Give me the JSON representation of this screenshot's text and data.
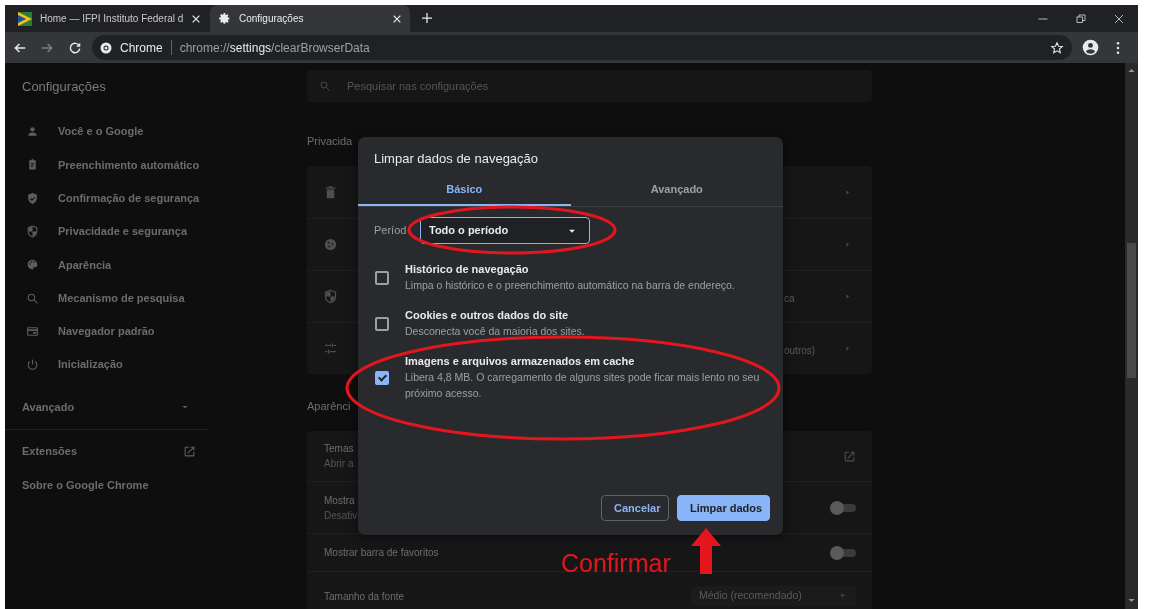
{
  "browser": {
    "tabs": [
      {
        "title": "Home — IFPI Instituto Federal d",
        "selected": false
      },
      {
        "title": "Configurações",
        "selected": true
      }
    ],
    "forward": {
      "disabled": true
    },
    "address": {
      "origin": "Chrome",
      "url": [
        {
          "text": "chrome://",
          "emphasized": false
        },
        {
          "text": "settings",
          "emphasized": true
        },
        {
          "text": "/clearBrowserData",
          "emphasized": false
        }
      ]
    }
  },
  "settings": {
    "title": "Configurações",
    "search": {
      "placeholder": "Pesquisar nas configurações"
    }
  },
  "sidebar": {
    "items": [
      {
        "label": "Você e o Google"
      },
      {
        "label": "Preenchimento automático"
      },
      {
        "label": "Confirmação de segurança"
      },
      {
        "label": "Privacidade e segurança"
      },
      {
        "label": "Aparência"
      },
      {
        "label": "Mecanismo de pesquisa"
      },
      {
        "label": "Navegador padrão"
      },
      {
        "label": "Inicialização"
      }
    ],
    "advanced": {
      "label": "Avançado",
      "expanded": false
    },
    "links": [
      {
        "label": "Extensões",
        "external": true
      },
      {
        "label": "Sobre o Google Chrome",
        "external": false
      }
    ]
  },
  "sections": [
    {
      "heading": "Privacida",
      "rows": [
        {
          "kind": "nav"
        },
        {
          "kind": "nav"
        },
        {
          "kind": "nav",
          "tail": "ca"
        },
        {
          "kind": "nav",
          "tail": "outros)"
        }
      ]
    },
    {
      "heading": "Aparênci",
      "rows": [
        {
          "kind": "external",
          "title": "Temas",
          "subtitle": "Abrir a"
        },
        {
          "kind": "toggle",
          "title": "Mostra",
          "subtitle": "Desativ",
          "on": false
        },
        {
          "kind": "toggle",
          "title": "Mostrar barra de favoritos",
          "on": false
        },
        {
          "kind": "select",
          "title": "Tamanho da fonte",
          "value": "Médio (recomendado)"
        }
      ]
    }
  ],
  "dialog": {
    "title": "Limpar dados de navegação",
    "tabs": [
      {
        "label": "Básico",
        "selected": true
      },
      {
        "label": "Avançado",
        "selected": false
      }
    ],
    "period": {
      "label": "Períod",
      "value": "Todo o período"
    },
    "options": [
      {
        "title": "Histórico de navegação",
        "description": "Limpa o histórico e o preenchimento automático na barra de endereço.",
        "checked": false
      },
      {
        "title": "Cookies e outros dados do site",
        "description": "Desconecta você da maioria dos sites.",
        "checked": false
      },
      {
        "title": "Imagens e arquivos armazenados em cache",
        "description": "Libera 4,8 MB. O carregamento de alguns sites pode ficar mais lento no seu próximo acesso.",
        "checked": true
      }
    ],
    "buttons": [
      {
        "label": "Cancelar",
        "kind": "secondary"
      },
      {
        "label": "Limpar dados",
        "kind": "primary"
      }
    ]
  },
  "annotation": {
    "label": "Confirmar"
  }
}
